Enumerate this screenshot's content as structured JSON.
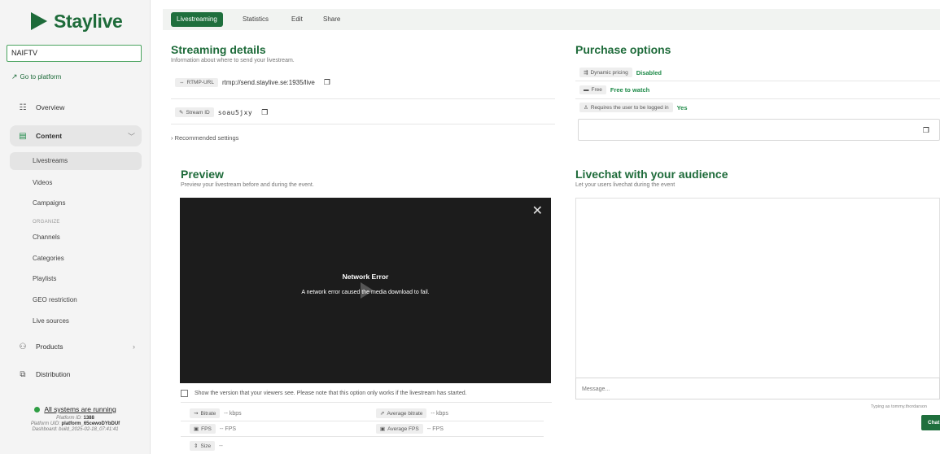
{
  "brand": {
    "name": "Staylive"
  },
  "sidebar": {
    "platform_value": "NAIFTV",
    "goto_platform": "Go to platform",
    "nav": {
      "overview": "Overview",
      "content": "Content",
      "products": "Products",
      "distribution": "Distribution"
    },
    "content_items": [
      "Livestreams",
      "Videos",
      "Campaigns"
    ],
    "organize_label": "ORGANIZE",
    "organize_items": [
      "Channels",
      "Categories",
      "Playlists",
      "GEO restriction",
      "Live sources"
    ],
    "status": "All systems are running",
    "meta": {
      "platform_id_label": "Platform ID:",
      "platform_id": "1388",
      "platform_uid_label": "Platform UID:",
      "platform_uid": "platform_65cewoDYbDUf",
      "dashboard_build": "Dashboard: build_2025-02-18_07:41:41"
    }
  },
  "tabs": [
    "Livestreaming",
    "Statistics",
    "Edit",
    "Share"
  ],
  "streaming": {
    "title": "Streaming details",
    "subtitle": "Information about where to send your livestream.",
    "rtmp_label": "RTMP-URL",
    "rtmp_value": "rtmp://send.staylive.se:1935/live",
    "stream_id_label": "Stream ID",
    "stream_id_value": "soau5jxy",
    "recommended": "Recommended settings"
  },
  "purchase": {
    "title": "Purchase options",
    "dynamic_label": "Dynamic pricing",
    "dynamic_value": "Disabled",
    "free_label": "Free",
    "free_value": "Free to watch",
    "login_label": "Requires the user to be logged in",
    "login_value": "Yes"
  },
  "preview": {
    "title": "Preview",
    "subtitle": "Preview your livestream before and during the event.",
    "error_title": "Network Error",
    "error_message": "A network error caused the media download to fail.",
    "viewer_option": "Show the version that your viewers see. Please note that this option only works if the livestream has started.",
    "stats": {
      "bitrate_label": "Bitrate",
      "bitrate_value": "-- kbps",
      "avg_bitrate_label": "Average bitrate",
      "avg_bitrate_value": "-- kbps",
      "fps_label": "FPS",
      "fps_value": "-- FPS",
      "avg_fps_label": "Average FPS",
      "avg_fps_value": "-- FPS",
      "size_label": "Size",
      "size_value": "--"
    }
  },
  "livechat": {
    "title": "Livechat with your audience",
    "subtitle": "Let your users livechat during the event",
    "placeholder": "Message...",
    "typing_as": "Typing as tommy.thordarson",
    "chat_button": "Chat"
  },
  "colors": {
    "accent": "#1e6b3a",
    "accent_dark": "#1f6f3d",
    "status_green": "#2f9e44"
  }
}
